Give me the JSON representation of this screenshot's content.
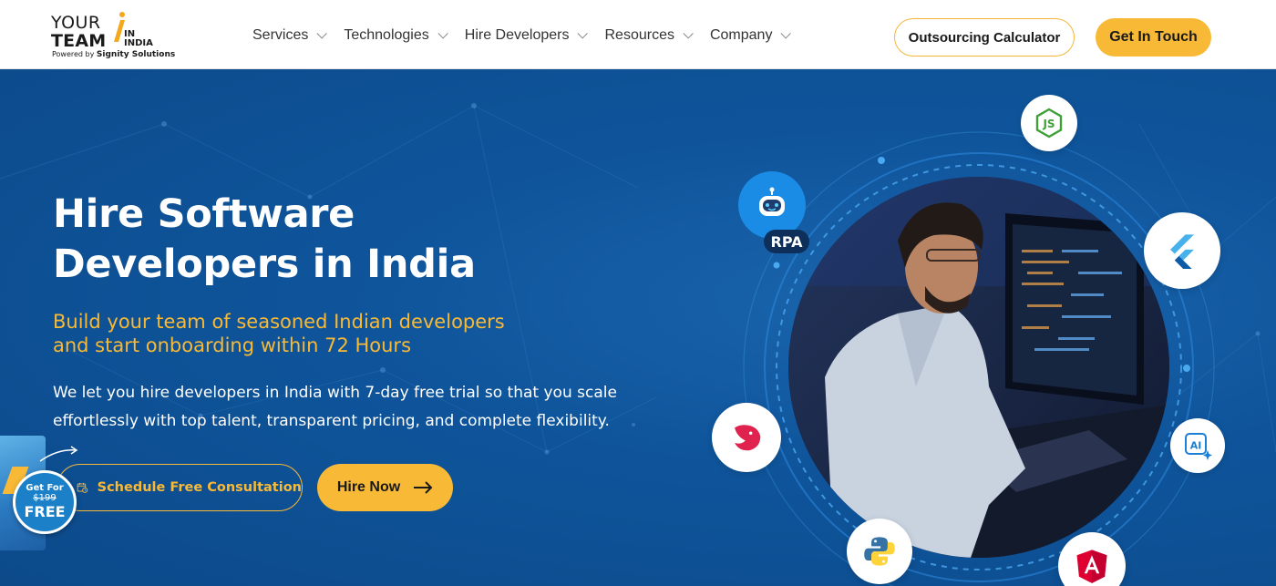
{
  "brand": {
    "line1": "YOUR",
    "line2": "TEAM",
    "in_a": "IN",
    "in_b": "INDIA",
    "powered_prefix": "Powered by",
    "powered_company": "Signity Solutions"
  },
  "nav": {
    "items": [
      {
        "label": "Services"
      },
      {
        "label": "Technologies"
      },
      {
        "label": "Hire Developers"
      },
      {
        "label": "Resources"
      },
      {
        "label": "Company"
      }
    ],
    "outsourcing_label": "Outsourcing Calculator",
    "contact_label": "Get In Touch"
  },
  "hero": {
    "title_line1": "Hire Software",
    "title_line2": "Developers in India",
    "subtitle_line1": "Build your team of seasoned Indian developers",
    "subtitle_line2": "and start onboarding within 72 Hours",
    "body_line1": "We let you hire developers in India with 7-day free trial so that you scale",
    "body_line2": "effortlessly with top talent, transparent pricing, and complete flexibility.",
    "consult_label": "Schedule Free Consultation",
    "hire_label": "Hire Now"
  },
  "promo": {
    "get": "Get For",
    "old_price": "$199",
    "free": "FREE"
  },
  "tech_badges": {
    "rpa": "RPA",
    "js": "JS",
    "ai": "AI"
  },
  "colors": {
    "accent": "#f8b936",
    "hero_bg": "#0d4f93",
    "header_bg": "#ffffff"
  },
  "icons": [
    "chevron-down-icon",
    "calendar-icon",
    "arrow-right-icon",
    "nodejs-icon",
    "flutter-icon",
    "robot-icon",
    "nestjs-icon",
    "ai-icon",
    "python-icon",
    "angular-icon"
  ]
}
